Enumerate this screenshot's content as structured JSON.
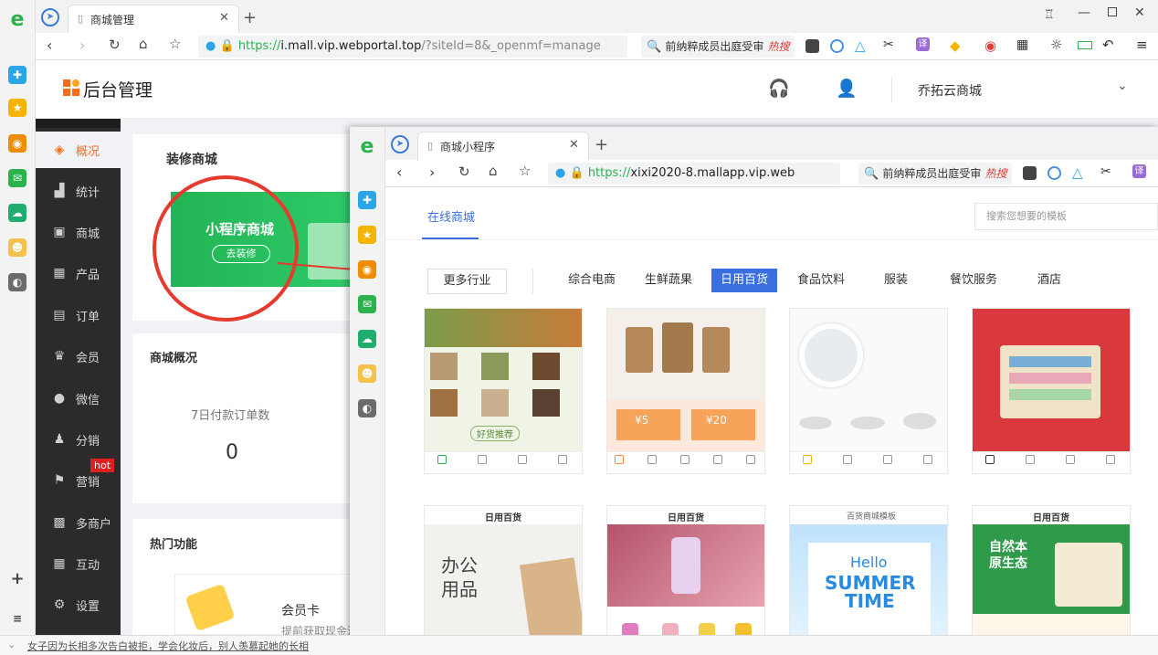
{
  "browser": {
    "tab_title": "商城管理",
    "url_green": "https://",
    "url_domain": "i.mall.vip.webportal.top",
    "url_rest": "/?siteId=8&_openmf=manage",
    "search_text": "前纳粹成员出庭受审",
    "search_engine": "热搜"
  },
  "header": {
    "logo_text": "后台管理",
    "shop_name": "乔拓云商城"
  },
  "nav": {
    "items": [
      {
        "label": "概况"
      },
      {
        "label": "统计"
      },
      {
        "label": "商城"
      },
      {
        "label": "产品"
      },
      {
        "label": "订单"
      },
      {
        "label": "会员"
      },
      {
        "label": "微信"
      },
      {
        "label": "分销"
      },
      {
        "label": "营销",
        "badge": "hot"
      },
      {
        "label": "多商户"
      },
      {
        "label": "互动"
      },
      {
        "label": "设置"
      }
    ]
  },
  "main": {
    "decorate_title": "装修商城",
    "miniapp_title": "小程序商城",
    "decorate_button": "去装修",
    "overview_title": "商城概况",
    "overview_stat_label": "7日付款订单数",
    "overview_stat_value": "0",
    "hot_title": "热门功能",
    "member_card": "会员卡",
    "member_card_sub": "提前获取现金流"
  },
  "popup": {
    "tab_title": "商城小程序",
    "url_green": "https://",
    "url_domain": "xixi2020-8.mallapp.vip.web",
    "search_text": "前纳粹成员出庭受审",
    "search_engine": "热搜",
    "tab_online": "在线商城",
    "search_placeholder": "搜索您想要的模板",
    "more_industry": "更多行业",
    "categories": [
      "综合电商",
      "生鲜蔬果",
      "日用百货",
      "食品饮料",
      "服装",
      "餐饮服务",
      "酒店"
    ],
    "active_category": "日用百货",
    "row2_header": "日用百货",
    "hello": "Hello",
    "summer": "SUMMER",
    "time": "TIME",
    "summer_sub": "百货商城模板",
    "office": "办公用品",
    "natural": "自然本原生态",
    "coupon1": "¥5",
    "coupon2": "¥20",
    "good_recommend": "好货推荐"
  },
  "status": {
    "text": "女子因为长相多次告白被拒，学会化妆后，别人羡慕起她的长相"
  },
  "colors": {
    "accent_orange": "#ff6a1a",
    "green": "#20c55a",
    "nav_bg": "#2b2b2b",
    "active_blue": "#3b6fe0",
    "annotation_red": "#e63a2e"
  }
}
